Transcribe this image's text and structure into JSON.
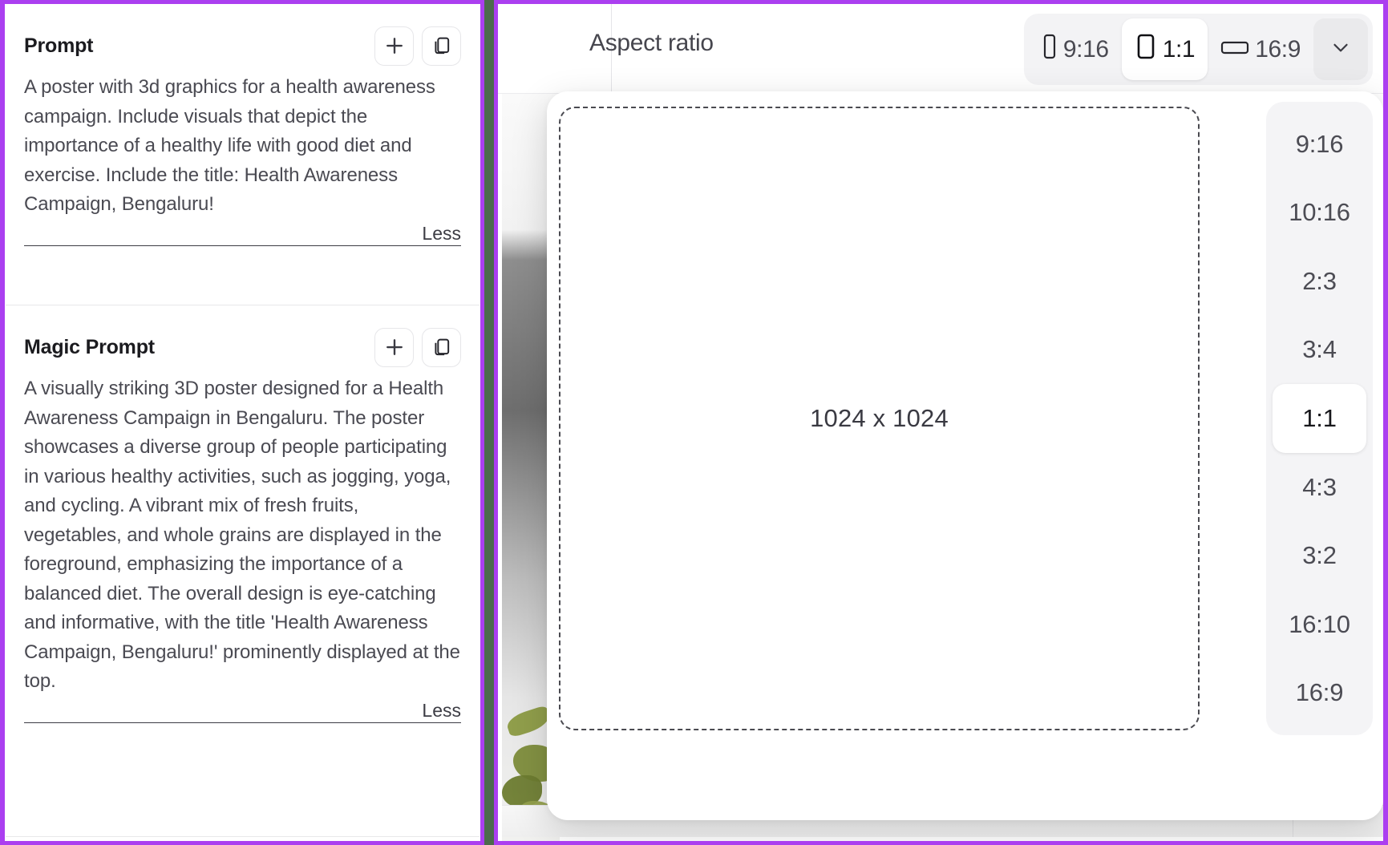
{
  "theme": {
    "accent_purple": "#ab3ff0",
    "divider_green": "#4c6b4c",
    "panel_bg": "#ffffff",
    "segment_bg": "#f3f3f5",
    "text_primary": "#1b1b1f",
    "text_secondary": "#4a4a52"
  },
  "left_panel": {
    "prompt_card": {
      "title": "Prompt",
      "add_icon": "plus-icon",
      "copy_icon": "copy-icon",
      "body": "A poster with 3d graphics for a health awareness campaign. Include visuals that depict the importance of a healthy life with good diet and exercise. Include the title: Health Awareness Campaign, Bengaluru!",
      "toggle_label": "Less"
    },
    "magic_prompt_card": {
      "title": "Magic Prompt",
      "add_icon": "plus-icon",
      "copy_icon": "copy-icon",
      "body": "A visually striking 3D poster designed for a Health Awareness Campaign in Bengaluru. The poster showcases a diverse group of people participating in various healthy activities, such as jogging, yoga, and cycling. A vibrant mix of fresh fruits, vegetables, and whole grains are displayed in the foreground, emphasizing the importance of a balanced diet. The overall design is eye-catching and informative, with the title 'Health Awareness Campaign, Bengaluru!' prominently displayed at the top.",
      "toggle_label": "Less"
    }
  },
  "right_panel": {
    "toolbar": {
      "label": "Aspect ratio",
      "segments": [
        {
          "value": "9:16",
          "icon": "portrait-rect-icon",
          "active": false
        },
        {
          "value": "1:1",
          "icon": "square-rect-icon",
          "active": true
        },
        {
          "value": "16:9",
          "icon": "landscape-rect-icon",
          "active": false
        }
      ],
      "caret_icon": "chevron-down-icon"
    },
    "popup": {
      "preview_dimensions": "1024 x 1024",
      "ratio_options": [
        {
          "value": "9:16",
          "active": false
        },
        {
          "value": "10:16",
          "active": false
        },
        {
          "value": "2:3",
          "active": false
        },
        {
          "value": "3:4",
          "active": false
        },
        {
          "value": "1:1",
          "active": true
        },
        {
          "value": "4:3",
          "active": false
        },
        {
          "value": "3:2",
          "active": false
        },
        {
          "value": "16:10",
          "active": false
        },
        {
          "value": "16:9",
          "active": false
        }
      ]
    }
  }
}
